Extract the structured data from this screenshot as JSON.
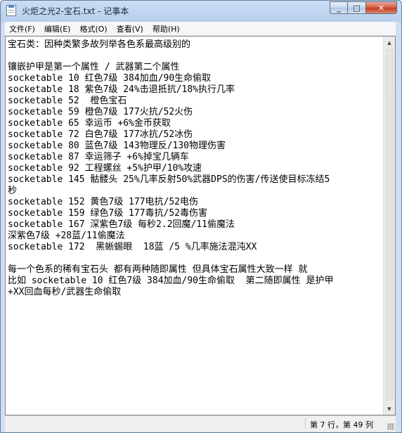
{
  "window": {
    "title": "火炬之光2-宝石.txt - 记事本",
    "minimize_glyph": "_",
    "maximize_glyph": "□",
    "close_glyph": "✕"
  },
  "menu": [
    {
      "label": "文件(F)"
    },
    {
      "label": "编辑(E)"
    },
    {
      "label": "格式(O)"
    },
    {
      "label": "查看(V)"
    },
    {
      "label": "帮助(H)"
    }
  ],
  "document": {
    "lines": [
      "宝石类：因种类繁多故列举各色系最高级别的",
      "",
      "镶嵌护甲是第一个属性 / 武器第二个属性",
      "socketable 10 红色7级 384加血/90生命偷取",
      "socketable 18 紫色7级 24%击退抵抗/18%执行几率",
      "socketable 52  橙色宝石",
      "socketable 59 橙色7级 177火抗/52火伤",
      "socketable 65 幸运币 +6%金币获取",
      "socketable 72 白色7级 177冰抗/52冰伤",
      "socketable 80 蓝色7级 143物理反/130物理伤害",
      "socketable 87 幸运筛子 +6%掉宝几辆车",
      "socketable 92 工程螺丝 +5%护甲/10%攻速",
      "socketable 145 骷髅头 25%几率反射50%武器DPS的伤害/传送使目标冻结5",
      "秒",
      "socketable 152 黄色7级 177电抗/52电伤",
      "socketable 159 绿色7级 177毒抗/52毒伤害",
      "socketable 167 深紫色7级 每秒2.2回魔/11偷魔法",
      "深紫色7级 +28蓝/11偷魔法",
      "socketable 172  黑蜥蜴眼  18蓝 /5 %几率施法混沌XX",
      "",
      "每一个色系的稀有宝石头 都有两种随即属性 但具体宝石属性大致一样 就",
      "比如 socketable 10 红色7级 384加血/90生命偷取  第二随即属性 是护甲",
      "+XX回血每秒/武器生命偷取"
    ]
  },
  "statusbar": {
    "position": "第 7 行，第 49 列"
  }
}
